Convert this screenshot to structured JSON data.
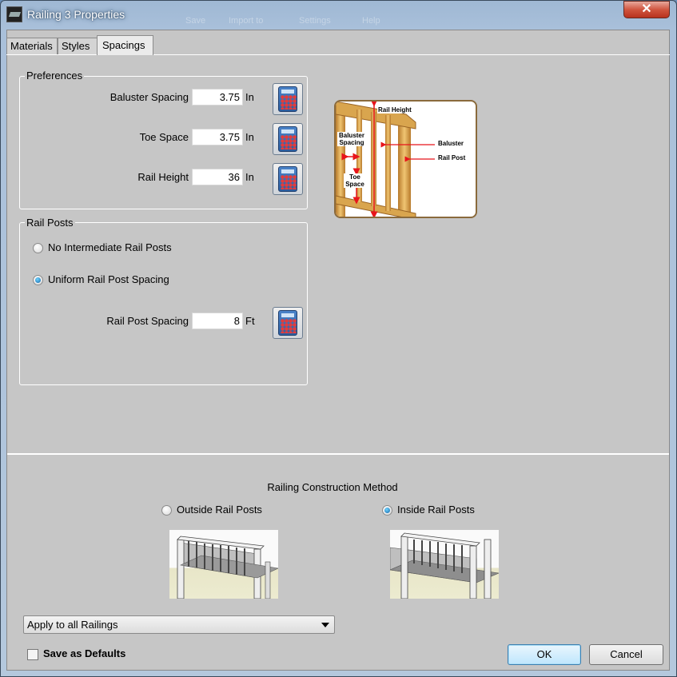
{
  "window": {
    "title": "Railing 3 Properties",
    "close_glyph": "✕",
    "ghost_toolbar": [
      "Save",
      "Import to",
      "Settings",
      "Help"
    ]
  },
  "tabs": [
    {
      "label": "Materials",
      "active": false
    },
    {
      "label": "Styles",
      "active": false
    },
    {
      "label": "Spacings",
      "active": true
    }
  ],
  "preferences": {
    "group_label": "Preferences",
    "rows": [
      {
        "label": "Baluster Spacing",
        "value": "3.75",
        "unit": "In"
      },
      {
        "label": "Toe Space",
        "value": "3.75",
        "unit": "In"
      },
      {
        "label": "Rail Height",
        "value": "36",
        "unit": "In"
      }
    ]
  },
  "rail_posts": {
    "group_label": "Rail Posts",
    "options": [
      {
        "label": "No Intermediate Rail Posts",
        "selected": false
      },
      {
        "label": "Uniform Rail Post Spacing",
        "selected": true
      }
    ],
    "spacing": {
      "label": "Rail Post Spacing",
      "value": "8",
      "unit": "Ft"
    }
  },
  "diagram": {
    "labels": {
      "rail_height": "Rail Height",
      "baluster_spacing_1": "Baluster",
      "baluster_spacing_2": "Spacing",
      "baluster": "Baluster",
      "rail_post": "Rail Post",
      "toe_space_1": "Toe",
      "toe_space_2": "Space"
    }
  },
  "construction": {
    "title": "Railing Construction Method",
    "options": [
      {
        "label": "Outside Rail Posts",
        "selected": false
      },
      {
        "label": "Inside Rail Posts",
        "selected": true
      }
    ]
  },
  "apply_dropdown": {
    "selected": "Apply to all Railings"
  },
  "save_defaults": {
    "label": "Save as Defaults",
    "checked": false
  },
  "buttons": {
    "ok": "OK",
    "cancel": "Cancel"
  },
  "colors": {
    "accent": "#3c7fb1",
    "close": "#c8412b",
    "wood": "#d9a54e",
    "arrow": "#e8141b"
  }
}
